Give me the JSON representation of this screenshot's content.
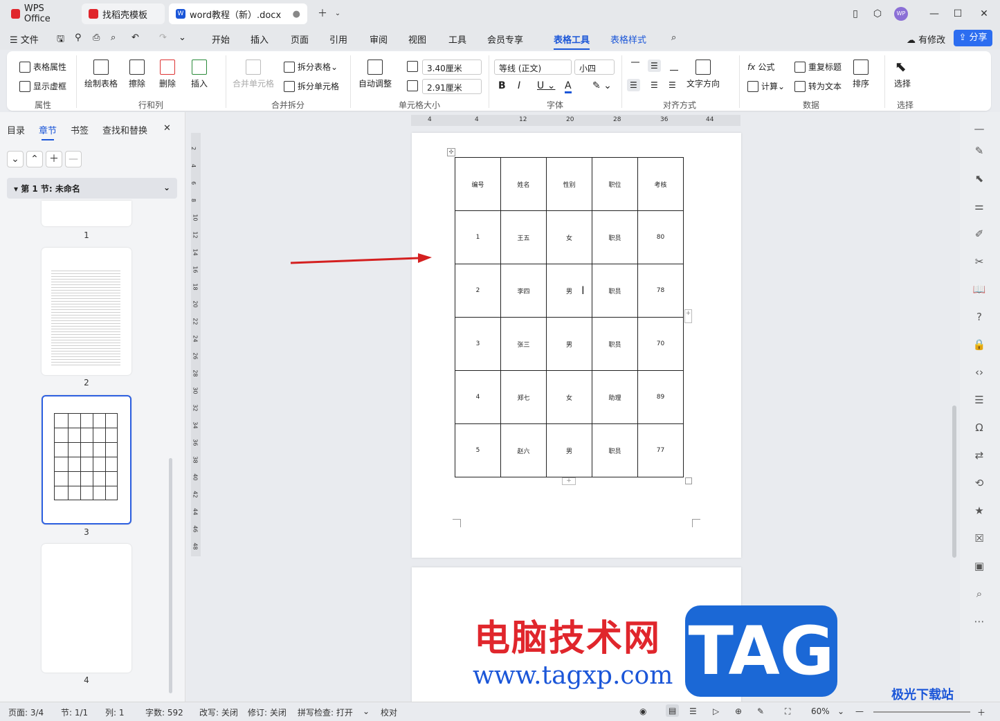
{
  "titlebar": {
    "tabs": [
      {
        "label": "WPS Office"
      },
      {
        "label": "找稻壳模板"
      },
      {
        "label": "word教程（新）.docx"
      }
    ],
    "avatar": "WP"
  },
  "menubar": {
    "file": "文件",
    "items": [
      "开始",
      "插入",
      "页面",
      "引用",
      "审阅",
      "视图",
      "工具",
      "会员专享",
      "表格工具",
      "表格样式"
    ],
    "status": "有修改",
    "share": "分享"
  },
  "ribbon": {
    "table_props": "表格属性",
    "show_grid": "显示虚框",
    "group_props": "属性",
    "draw_table": "绘制表格",
    "erase": "擦除",
    "delete": "删除",
    "insert": "插入",
    "group_rows": "行和列",
    "merge_cells": "合并单元格",
    "split_table": "拆分表格",
    "split_cells": "拆分单元格",
    "group_merge": "合并拆分",
    "auto_fit": "自动调整",
    "width": "3.40厘米",
    "height": "2.91厘米",
    "group_cellsize": "单元格大小",
    "font_name": "等线 (正文)",
    "font_size": "小四",
    "group_font": "字体",
    "text_direction": "文字方向",
    "group_align": "对齐方式",
    "formula": "公式",
    "calc": "计算",
    "repeat_header": "重复标题",
    "to_text": "转为文本",
    "sort": "排序",
    "group_data": "数据",
    "select": "选择",
    "group_select": "选择"
  },
  "leftpane": {
    "tabs": [
      "目录",
      "章节",
      "书签",
      "查找和替换"
    ],
    "section": "第 1 节: 未命名",
    "page_labels": [
      "1",
      "2",
      "3",
      "4"
    ]
  },
  "ruler": {
    "h_ticks": [
      "4",
      "4",
      "12",
      "20",
      "28",
      "36",
      "44"
    ],
    "v_ticks": [
      "2",
      "4",
      "6",
      "8",
      "10",
      "12",
      "14",
      "16",
      "18",
      "20",
      "22",
      "24",
      "26",
      "28",
      "30",
      "32",
      "34",
      "36",
      "38",
      "40",
      "42",
      "44",
      "46",
      "48"
    ]
  },
  "table": {
    "headers": [
      "编号",
      "姓名",
      "性别",
      "职位",
      "考核"
    ],
    "rows": [
      [
        "1",
        "王五",
        "女",
        "职员",
        "80"
      ],
      [
        "2",
        "李四",
        "男",
        "职员",
        "78"
      ],
      [
        "3",
        "张三",
        "男",
        "职员",
        "70"
      ],
      [
        "4",
        "郑七",
        "女",
        "助理",
        "89"
      ],
      [
        "5",
        "赵六",
        "男",
        "职员",
        "77"
      ]
    ]
  },
  "statusbar": {
    "page": "页面: 3/4",
    "section": "节: 1/1",
    "col": "列: 1",
    "words": "字数: 592",
    "overwrite": "改写: 关闭",
    "revision": "修订: 关闭",
    "spell": "拼写检查: 打开",
    "proof": "校对",
    "zoom": "60%"
  },
  "watermark": {
    "title": "电脑技术网",
    "url": "www.tagxp.com",
    "tag": "TAG",
    "site2": "极光下载站"
  },
  "colors": {
    "accent": "#1b56d8",
    "arrow": "#d42020"
  }
}
